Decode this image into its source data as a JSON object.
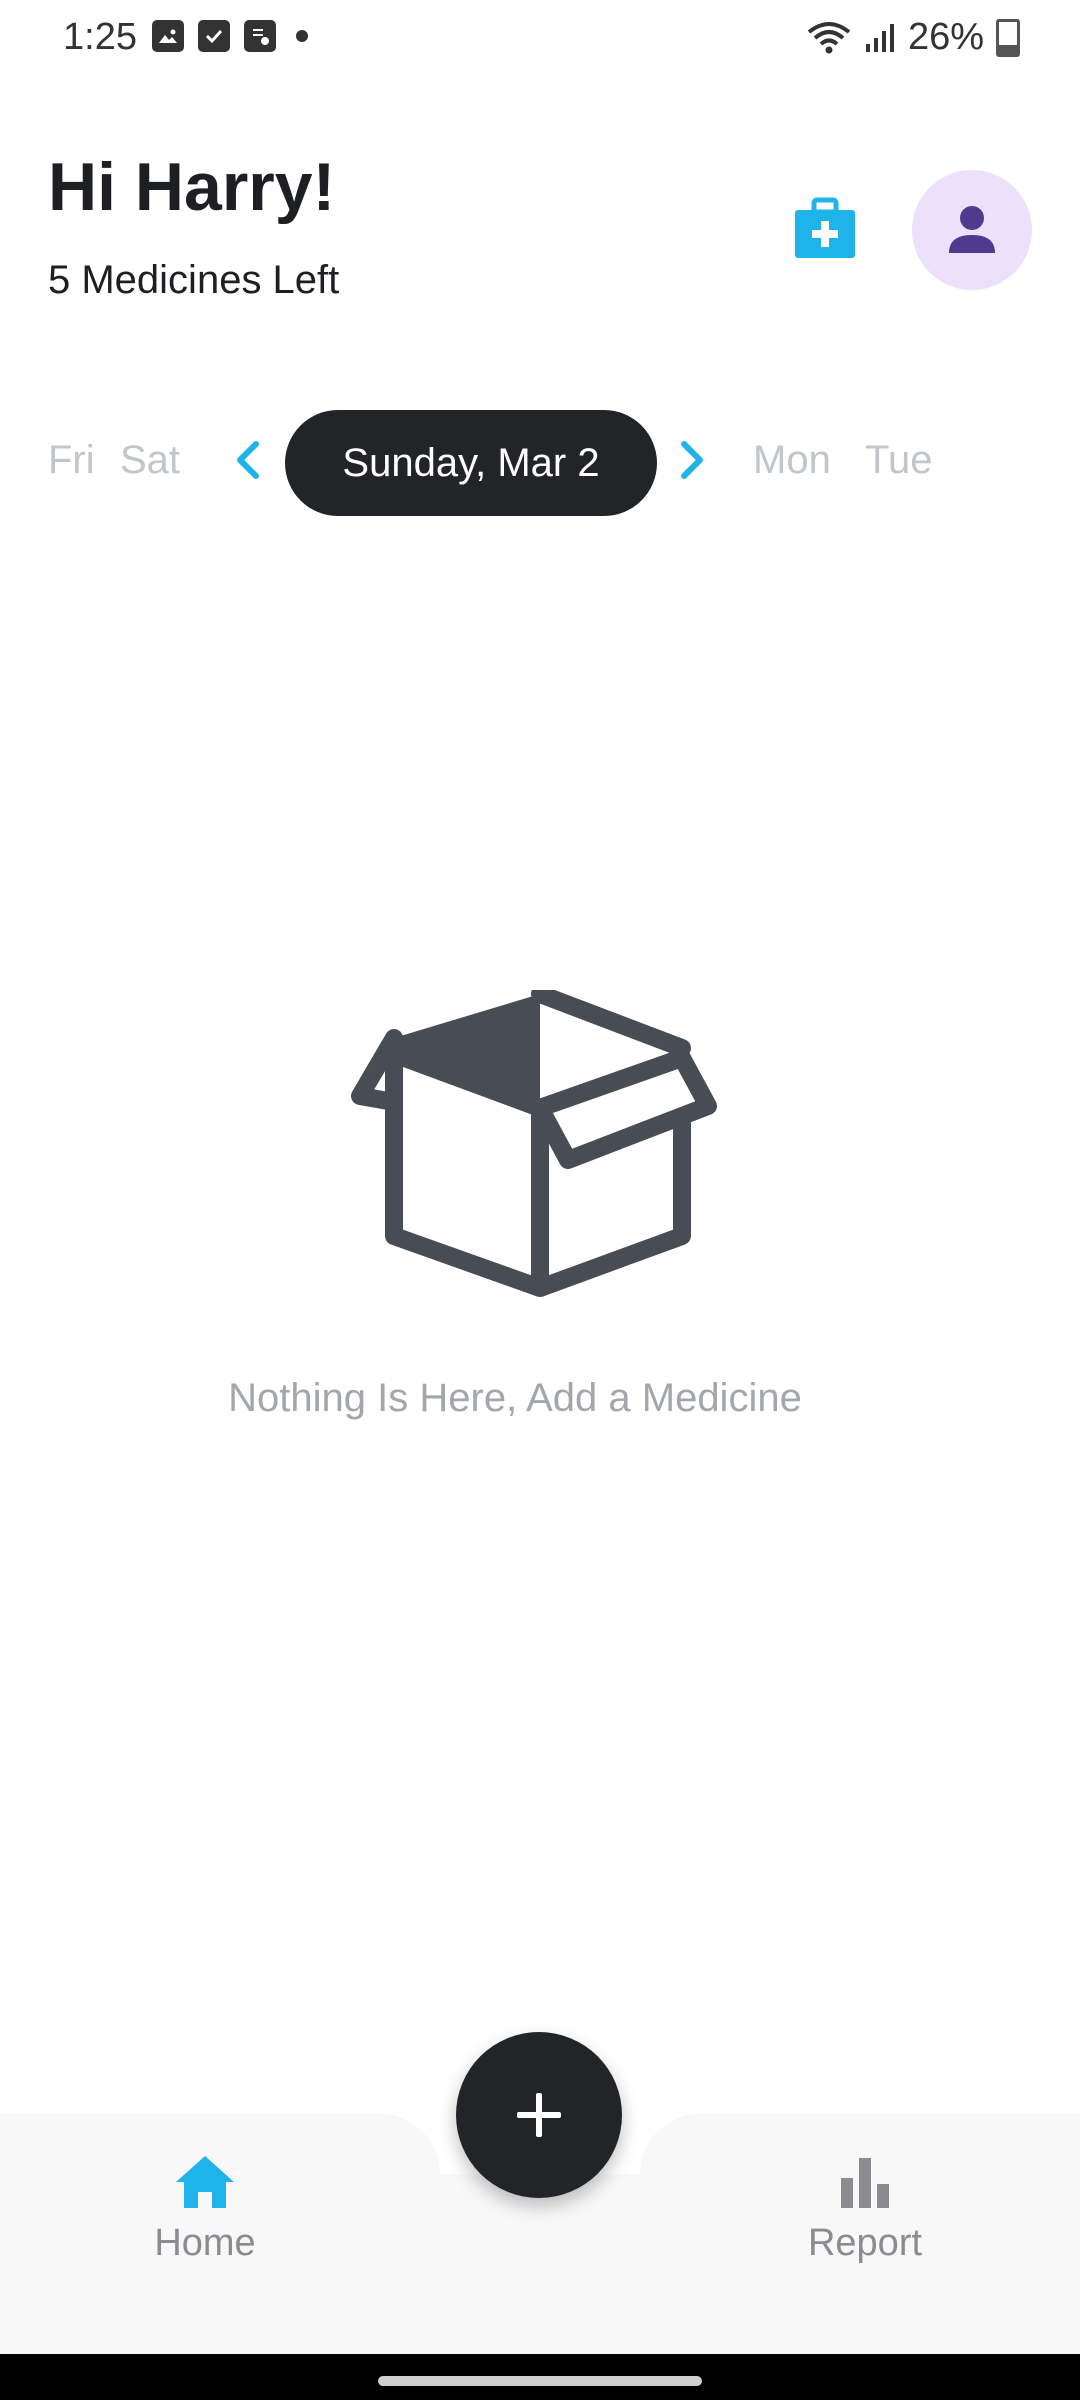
{
  "status_bar": {
    "time": "1:25",
    "battery": "26%",
    "icons": [
      "image-icon",
      "check-icon",
      "task-icon",
      "dot-icon",
      "wifi-icon",
      "signal-icon",
      "battery-icon"
    ]
  },
  "header": {
    "greeting": "Hi Harry!",
    "subtitle": "5 Medicines Left",
    "kit_icon": "medical-kit-icon",
    "avatar_icon": "person-icon"
  },
  "date_strip": {
    "prev_days": [
      "Fri",
      "Sat"
    ],
    "selected": "Sunday, Mar 2",
    "next_days": [
      "Mon",
      "Tue"
    ]
  },
  "empty_state": {
    "icon": "open-box-icon",
    "message": "Nothing Is Here, Add a Medicine"
  },
  "bottom_nav": {
    "items": [
      {
        "label": "Home",
        "icon": "home-icon",
        "active": true
      },
      {
        "label": "Report",
        "icon": "bar-chart-icon",
        "active": false
      }
    ],
    "fab_icon": "plus-icon"
  },
  "colors": {
    "accent": "#1eb4ea",
    "dark": "#222427",
    "avatar_bg": "#ece0fb",
    "avatar_fg": "#4f3a8f",
    "muted_day": "#c2c5c9",
    "empty_icon": "#474c55"
  }
}
